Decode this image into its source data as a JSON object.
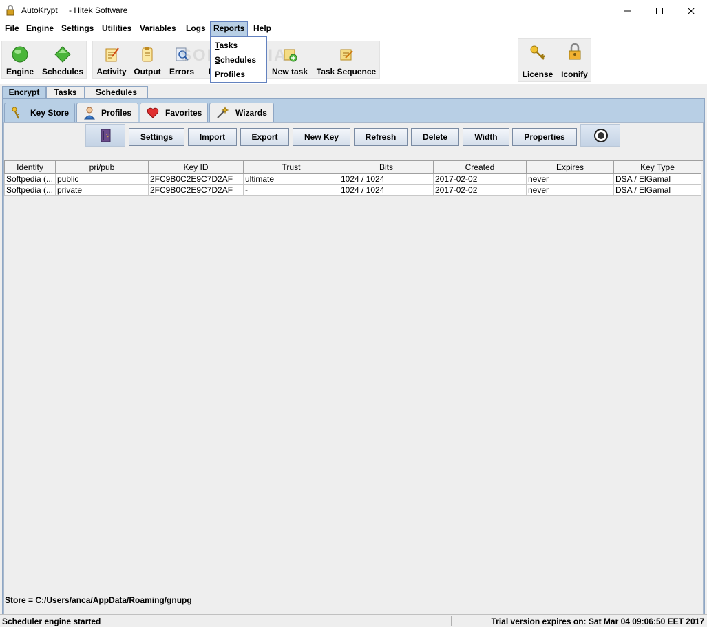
{
  "window": {
    "title": "AutoKrypt",
    "title_suffix": "- Hitek Software"
  },
  "menubar": [
    {
      "label": "File",
      "mnemonic": "F",
      "rest": "ile"
    },
    {
      "label": "Engine",
      "mnemonic": "E",
      "rest": "ngine"
    },
    {
      "label": "Settings",
      "mnemonic": "S",
      "rest": "ettings"
    },
    {
      "label": "Utilities",
      "mnemonic": "U",
      "rest": "tilities"
    },
    {
      "label": "Variables",
      "mnemonic": "V",
      "rest": "ariables"
    },
    {
      "label": "Logs",
      "mnemonic": "L",
      "rest": "ogs"
    },
    {
      "label": "Reports",
      "mnemonic": "R",
      "rest": "eports"
    },
    {
      "label": "Help",
      "mnemonic": "H",
      "rest": "elp"
    }
  ],
  "reports_menu": [
    {
      "mnemonic": "T",
      "rest": "asks"
    },
    {
      "mnemonic": "S",
      "rest": "chedules"
    },
    {
      "mnemonic": "P",
      "rest": "rofiles"
    }
  ],
  "toolbar": {
    "engine": "Engine",
    "schedules": "Schedules",
    "activity": "Activity",
    "output": "Output",
    "errors": "Errors",
    "hidden_partial": "D",
    "new_task": "New task",
    "task_sequence": "Task Sequence",
    "license": "License",
    "iconify": "Iconify"
  },
  "watermark": "SOFTPEDIA",
  "outer_tabs": [
    "Encrypt",
    "Tasks",
    "Schedules"
  ],
  "inner_tabs": [
    "Key Store",
    "Profiles",
    "Favorites",
    "Wizards"
  ],
  "buttons": [
    "Settings",
    "Import",
    "Export",
    "New Key",
    "Refresh",
    "Delete",
    "Width",
    "Properties"
  ],
  "table": {
    "headers": [
      "Identity",
      "pri/pub",
      "Key ID",
      "Trust",
      "Bits",
      "Created",
      "Expires",
      "Key Type"
    ],
    "rows": [
      [
        "Softpedia (...",
        "public",
        "2FC9B0C2E9C7D2AF",
        "ultimate",
        "1024 / 1024",
        "2017-02-02",
        "never",
        "DSA / ElGamal"
      ],
      [
        "Softpedia (...",
        "private",
        "2FC9B0C2E9C7D2AF",
        "-",
        "1024 / 1024",
        "2017-02-02",
        "never",
        "DSA / ElGamal"
      ]
    ]
  },
  "store_path": "Store   = C:/Users/anca/AppData/Roaming/gnupg",
  "status": {
    "left": "Scheduler engine started",
    "right": "Trial version expires on: Sat Mar 04 09:06:50 EET 2017"
  }
}
